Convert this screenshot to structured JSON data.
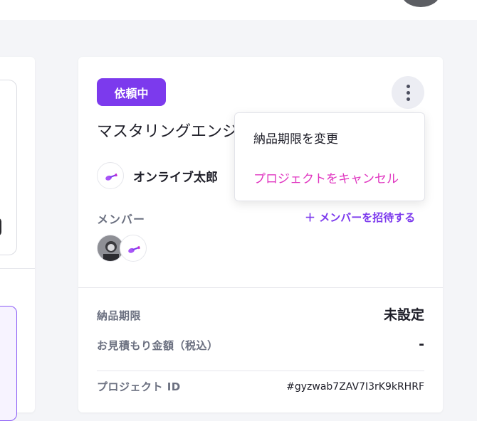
{
  "project": {
    "status_badge": "依頼中",
    "title": "マスタリングエンジニア募集",
    "owner_name": "オンライブ太郎",
    "members_label": "メンバー",
    "invite_label": "＋ メンバーを招待する",
    "details": {
      "deadline_label": "納品期限",
      "deadline_value": "未設定",
      "estimate_label": "お見積もり金額（税込）",
      "estimate_value": "-",
      "project_id_label": "プロジェクト ID",
      "project_id_value": "#gyzwab7ZAV7I3rK9kRHRF"
    }
  },
  "menu": {
    "items": [
      {
        "label": "納品期限を変更"
      },
      {
        "label": "プロジェクトをキャンセル"
      }
    ]
  },
  "icons": {
    "kebab": "more-vertical-icon",
    "owner_avatar": "guitar-icon",
    "member_avatar_photo": "user-photo",
    "member_avatar_guitar": "guitar-icon"
  },
  "colors": {
    "accent": "#7c3aed",
    "danger": "#e036c0",
    "page_bg": "#f4f5f8"
  }
}
